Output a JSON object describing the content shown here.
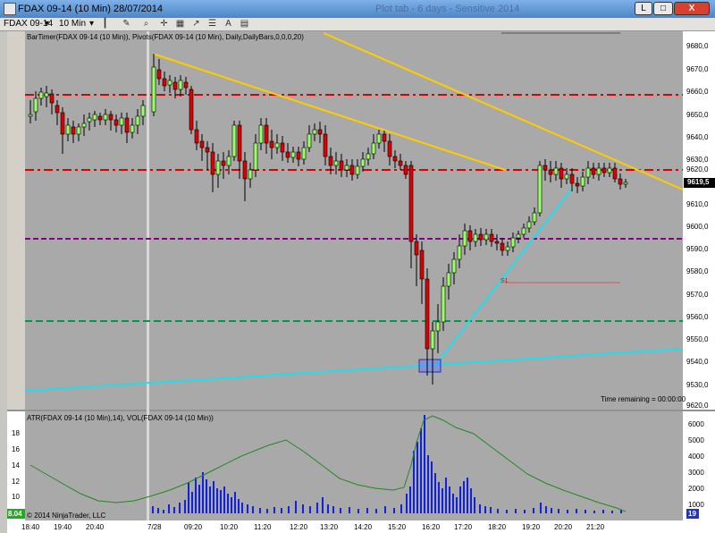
{
  "window": {
    "title": "FDAX 09-14 (10 Min)  28/07/2014",
    "ghost_title": "Plot tab - 6 days - Sensitive 2014",
    "min_label": "L",
    "restore_label": "□",
    "close_label": "X"
  },
  "toolbar": {
    "instrument": "FDAX 09-14",
    "interval": "10 Min",
    "icons": [
      "bars-icon",
      "pencil-icon",
      "zoom-icon",
      "crosshair-icon",
      "grid-icon",
      "arrow-icon",
      "properties-icon",
      "text-icon",
      "chart-icon"
    ]
  },
  "chart": {
    "indicator_label": "BarTimer(FDAX 09-14 (10 Min)), Pivots(FDAX 09-14 (10 Min), Daily,DailyBars,0,0,0,20)",
    "time_remaining": "Time remaining = 00:00:00",
    "pivot_s1_label": "S1",
    "current_price_label": "9619,5",
    "price_axis_labels": [
      "9680,0",
      "9670,0",
      "9660,0",
      "9650,0",
      "9640,0",
      "9630,0",
      "9620,0",
      "9610,0",
      "9600,0",
      "9590,0",
      "9580,0",
      "9570,0",
      "9560,0",
      "9550,0",
      "9540,0",
      "9530,0",
      "9620,0"
    ],
    "date_marker": "7/28",
    "time_labels": [
      "18:40",
      "19:40",
      "20:40",
      "7/28",
      "09:20",
      "10:20",
      "11:20",
      "12:20",
      "13:20",
      "14:20",
      "15:20",
      "16:20",
      "17:20",
      "18:20",
      "19:20",
      "20:20",
      "21:20"
    ],
    "pivot_colors": {
      "resistance": "#dd0000",
      "pivot": "#880088",
      "support": "#009944"
    },
    "trendline_colors": {
      "yellow": "#ffcc00",
      "cyan": "#22ddee"
    }
  },
  "atr_panel": {
    "indicator_label": "ATR(FDAX 09-14 (10 Min),14), VOL(FDAX 09-14 (10 Min))",
    "left_axis_labels": [
      "18",
      "16",
      "14",
      "12",
      "10"
    ],
    "right_axis_labels": [
      "6000",
      "5000",
      "4000",
      "3000",
      "2000",
      "1000"
    ],
    "atr_value": "8.04",
    "vol_value": "19",
    "copyright": "© 2014 NinjaTrader, LLC"
  }
}
